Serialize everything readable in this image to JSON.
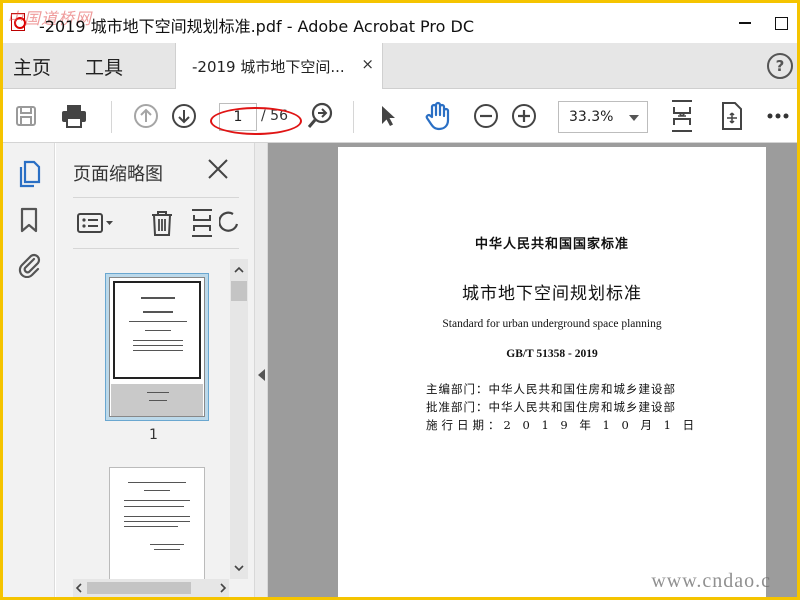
{
  "window": {
    "title": "-2019 城市地下空间规划标准.pdf - Adobe Acrobat Pro DC",
    "watermark": "中国道桥网"
  },
  "menubar": {
    "home": "主页",
    "tools": "工具",
    "tab_label": "-2019 城市地下空间...",
    "tab_close": "×",
    "help": "?"
  },
  "toolbar": {
    "current_page": "1",
    "page_total": "/ 56",
    "zoom": "33.3%"
  },
  "panel": {
    "title": "页面缩略图",
    "thumb_label": "1"
  },
  "document": {
    "org": "中华人民共和国国家标准",
    "title": "城市地下空间规划标准",
    "english_title": "Standard for urban underground space planning",
    "code": "GB/T 51358 - 2019",
    "editor": "主编部门：中华人民共和国住房和城乡建设部",
    "approver": "批准部门：中华人民共和国住房和城乡建设部",
    "effective": "施行日期：2 0 1 9 年 1 0 月 1 日"
  },
  "site_watermark": "www.cndao.c",
  "colors": {
    "frame": "#f5c400",
    "accent_blue": "#2a6fc4",
    "highlight_red": "#e01414"
  }
}
